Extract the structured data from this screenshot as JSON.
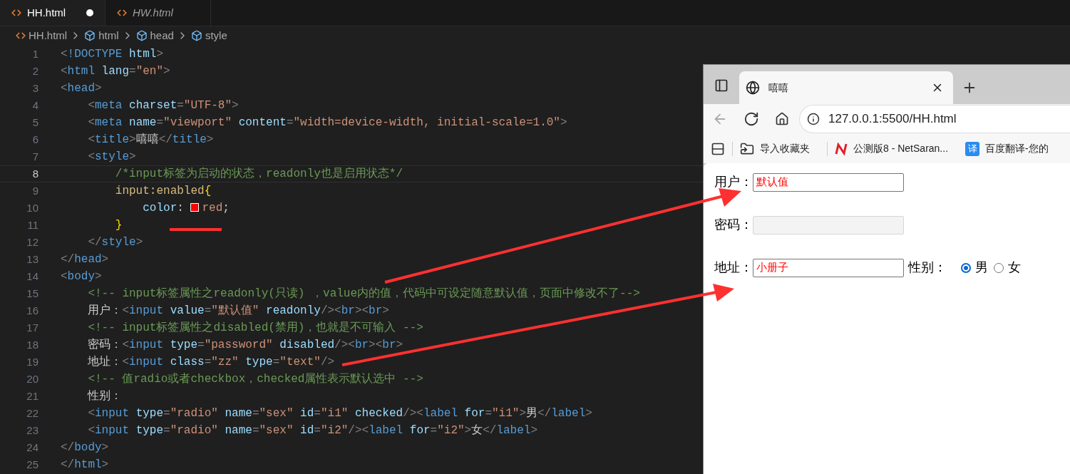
{
  "editor": {
    "tabs": [
      {
        "label": "HH.html",
        "selected": true,
        "modified": true,
        "italic": false
      },
      {
        "label": "HW.html",
        "selected": false,
        "modified": false,
        "italic": true
      }
    ],
    "breadcrumb": [
      {
        "kind": "file",
        "label": "HH.html"
      },
      {
        "kind": "element",
        "label": "html"
      },
      {
        "kind": "element",
        "label": "head"
      },
      {
        "kind": "element",
        "label": "style"
      }
    ],
    "lines": [
      {
        "number": "1",
        "current": false,
        "tokens": [
          {
            "kind": "p",
            "text": "<"
          },
          {
            "kind": "t",
            "text": "!DOCTYPE"
          },
          {
            "kind": "a",
            "text": " html"
          },
          {
            "kind": "p",
            "text": ">"
          }
        ]
      },
      {
        "number": "2",
        "current": false,
        "tokens": [
          {
            "kind": "p",
            "text": "<"
          },
          {
            "kind": "t",
            "text": "html"
          },
          {
            "kind": "a",
            "text": " lang"
          },
          {
            "kind": "p",
            "text": "="
          },
          {
            "kind": "s",
            "text": "\"en\""
          },
          {
            "kind": "p",
            "text": ">"
          }
        ]
      },
      {
        "number": "3",
        "current": false,
        "tokens": [
          {
            "kind": "p",
            "text": "<"
          },
          {
            "kind": "t",
            "text": "head"
          },
          {
            "kind": "p",
            "text": ">"
          }
        ]
      },
      {
        "number": "4",
        "current": false,
        "tokens": [
          {
            "kind": "p",
            "text": "    <"
          },
          {
            "kind": "t",
            "text": "meta"
          },
          {
            "kind": "a",
            "text": " charset"
          },
          {
            "kind": "p",
            "text": "="
          },
          {
            "kind": "s",
            "text": "\"UTF-8\""
          },
          {
            "kind": "p",
            "text": ">"
          }
        ]
      },
      {
        "number": "5",
        "current": false,
        "tokens": [
          {
            "kind": "p",
            "text": "    <"
          },
          {
            "kind": "t",
            "text": "meta"
          },
          {
            "kind": "a",
            "text": " name"
          },
          {
            "kind": "p",
            "text": "="
          },
          {
            "kind": "s",
            "text": "\"viewport\""
          },
          {
            "kind": "a",
            "text": " content"
          },
          {
            "kind": "p",
            "text": "="
          },
          {
            "kind": "s",
            "text": "\"width=device-width, initial-scale=1.0\""
          },
          {
            "kind": "p",
            "text": ">"
          }
        ]
      },
      {
        "number": "6",
        "current": false,
        "tokens": [
          {
            "kind": "p",
            "text": "    <"
          },
          {
            "kind": "t",
            "text": "title"
          },
          {
            "kind": "p",
            "text": ">"
          },
          {
            "kind": "x",
            "text": "嘻嘻"
          },
          {
            "kind": "p",
            "text": "</"
          },
          {
            "kind": "t",
            "text": "title"
          },
          {
            "kind": "p",
            "text": ">"
          }
        ]
      },
      {
        "number": "7",
        "current": false,
        "tokens": [
          {
            "kind": "p",
            "text": "    <"
          },
          {
            "kind": "t",
            "text": "style"
          },
          {
            "kind": "p",
            "text": ">"
          }
        ]
      },
      {
        "number": "8",
        "current": true,
        "tokens": [
          {
            "kind": "c",
            "text": "        /*input标签为启动的状态，readonly也是启用状态*/"
          }
        ]
      },
      {
        "number": "9",
        "current": false,
        "tokens": [
          {
            "kind": "sel",
            "text": "        input:enabled"
          },
          {
            "kind": "b",
            "text": "{"
          }
        ]
      },
      {
        "number": "10",
        "current": false,
        "tokens": [
          {
            "kind": "a",
            "text": "            color"
          },
          {
            "kind": "x",
            "text": ": "
          },
          {
            "kind": "swatch",
            "color": "#ff0000"
          },
          {
            "kind": "s",
            "text": "red"
          },
          {
            "kind": "x",
            "text": ";"
          }
        ]
      },
      {
        "number": "11",
        "current": false,
        "tokens": [
          {
            "kind": "b",
            "text": "        }"
          }
        ]
      },
      {
        "number": "12",
        "current": false,
        "tokens": [
          {
            "kind": "p",
            "text": "    </"
          },
          {
            "kind": "t",
            "text": "style"
          },
          {
            "kind": "p",
            "text": ">"
          }
        ]
      },
      {
        "number": "13",
        "current": false,
        "tokens": [
          {
            "kind": "p",
            "text": "</"
          },
          {
            "kind": "t",
            "text": "head"
          },
          {
            "kind": "p",
            "text": ">"
          }
        ]
      },
      {
        "number": "14",
        "current": false,
        "tokens": [
          {
            "kind": "p",
            "text": "<"
          },
          {
            "kind": "t",
            "text": "body"
          },
          {
            "kind": "p",
            "text": ">"
          }
        ]
      },
      {
        "number": "15",
        "current": false,
        "tokens": [
          {
            "kind": "c",
            "text": "    <!-- input标签属性之readonly(只读) ，value内的值，代码中可设定随意默认值，页面中修改不了-->"
          }
        ]
      },
      {
        "number": "16",
        "current": false,
        "tokens": [
          {
            "kind": "x",
            "text": "    用户："
          },
          {
            "kind": "p",
            "text": "<"
          },
          {
            "kind": "t",
            "text": "input"
          },
          {
            "kind": "a",
            "text": " value"
          },
          {
            "kind": "p",
            "text": "="
          },
          {
            "kind": "s",
            "text": "\"默认值\""
          },
          {
            "kind": "a",
            "text": " readonly"
          },
          {
            "kind": "p",
            "text": "/><"
          },
          {
            "kind": "t",
            "text": "br"
          },
          {
            "kind": "p",
            "text": "><"
          },
          {
            "kind": "t",
            "text": "br"
          },
          {
            "kind": "p",
            "text": ">"
          }
        ]
      },
      {
        "number": "17",
        "current": false,
        "tokens": [
          {
            "kind": "c",
            "text": "    <!-- input标签属性之disabled(禁用)，也就是不可输入 -->"
          }
        ]
      },
      {
        "number": "18",
        "current": false,
        "tokens": [
          {
            "kind": "x",
            "text": "    密码："
          },
          {
            "kind": "p",
            "text": "<"
          },
          {
            "kind": "t",
            "text": "input"
          },
          {
            "kind": "a",
            "text": " type"
          },
          {
            "kind": "p",
            "text": "="
          },
          {
            "kind": "s",
            "text": "\"password\""
          },
          {
            "kind": "a",
            "text": " disabled"
          },
          {
            "kind": "p",
            "text": "/><"
          },
          {
            "kind": "t",
            "text": "br"
          },
          {
            "kind": "p",
            "text": "><"
          },
          {
            "kind": "t",
            "text": "br"
          },
          {
            "kind": "p",
            "text": ">"
          }
        ]
      },
      {
        "number": "19",
        "current": false,
        "tokens": [
          {
            "kind": "x",
            "text": "    地址："
          },
          {
            "kind": "p",
            "text": "<"
          },
          {
            "kind": "t",
            "text": "input"
          },
          {
            "kind": "a",
            "text": " class"
          },
          {
            "kind": "p",
            "text": "="
          },
          {
            "kind": "s",
            "text": "\"zz\""
          },
          {
            "kind": "a",
            "text": " type"
          },
          {
            "kind": "p",
            "text": "="
          },
          {
            "kind": "s",
            "text": "\"text\""
          },
          {
            "kind": "p",
            "text": "/>"
          }
        ]
      },
      {
        "number": "20",
        "current": false,
        "tokens": [
          {
            "kind": "c",
            "text": "    <!-- 值radio或者checkbox，checked属性表示默认选中 -->"
          }
        ]
      },
      {
        "number": "21",
        "current": false,
        "tokens": [
          {
            "kind": "x",
            "text": "    性别："
          }
        ]
      },
      {
        "number": "22",
        "current": false,
        "tokens": [
          {
            "kind": "p",
            "text": "    <"
          },
          {
            "kind": "t",
            "text": "input"
          },
          {
            "kind": "a",
            "text": " type"
          },
          {
            "kind": "p",
            "text": "="
          },
          {
            "kind": "s",
            "text": "\"radio\""
          },
          {
            "kind": "a",
            "text": " name"
          },
          {
            "kind": "p",
            "text": "="
          },
          {
            "kind": "s",
            "text": "\"sex\""
          },
          {
            "kind": "a",
            "text": " id"
          },
          {
            "kind": "p",
            "text": "="
          },
          {
            "kind": "s",
            "text": "\"i1\""
          },
          {
            "kind": "a",
            "text": " checked"
          },
          {
            "kind": "p",
            "text": "/><"
          },
          {
            "kind": "t",
            "text": "label"
          },
          {
            "kind": "a",
            "text": " for"
          },
          {
            "kind": "p",
            "text": "="
          },
          {
            "kind": "s",
            "text": "\"i1\""
          },
          {
            "kind": "p",
            "text": ">"
          },
          {
            "kind": "x",
            "text": "男"
          },
          {
            "kind": "p",
            "text": "</"
          },
          {
            "kind": "t",
            "text": "label"
          },
          {
            "kind": "p",
            "text": ">"
          }
        ]
      },
      {
        "number": "23",
        "current": false,
        "tokens": [
          {
            "kind": "p",
            "text": "    <"
          },
          {
            "kind": "t",
            "text": "input"
          },
          {
            "kind": "a",
            "text": " type"
          },
          {
            "kind": "p",
            "text": "="
          },
          {
            "kind": "s",
            "text": "\"radio\""
          },
          {
            "kind": "a",
            "text": " name"
          },
          {
            "kind": "p",
            "text": "="
          },
          {
            "kind": "s",
            "text": "\"sex\""
          },
          {
            "kind": "a",
            "text": " id"
          },
          {
            "kind": "p",
            "text": "="
          },
          {
            "kind": "s",
            "text": "\"i2\""
          },
          {
            "kind": "p",
            "text": "/><"
          },
          {
            "kind": "t",
            "text": "label"
          },
          {
            "kind": "a",
            "text": " for"
          },
          {
            "kind": "p",
            "text": "="
          },
          {
            "kind": "s",
            "text": "\"i2\""
          },
          {
            "kind": "p",
            "text": ">"
          },
          {
            "kind": "x",
            "text": "女"
          },
          {
            "kind": "p",
            "text": "</"
          },
          {
            "kind": "t",
            "text": "label"
          },
          {
            "kind": "p",
            "text": ">"
          }
        ]
      },
      {
        "number": "24",
        "current": false,
        "tokens": [
          {
            "kind": "p",
            "text": "</"
          },
          {
            "kind": "t",
            "text": "body"
          },
          {
            "kind": "p",
            "text": ">"
          }
        ]
      },
      {
        "number": "25",
        "current": false,
        "tokens": [
          {
            "kind": "p",
            "text": "</"
          },
          {
            "kind": "t",
            "text": "html"
          },
          {
            "kind": "p",
            "text": ">"
          }
        ]
      }
    ]
  },
  "browser": {
    "tab": {
      "title": "嘻嘻"
    },
    "address": "127.0.0.1:5500/HH.html",
    "bookmarks": [
      {
        "kind": "folder",
        "label": "导入收藏夹"
      },
      {
        "kind": "netsarang",
        "label": "公测版8 - NetSaran..."
      },
      {
        "kind": "translate",
        "icon_text": "译",
        "label": "百度翻译-您的"
      }
    ],
    "form": {
      "fields": [
        {
          "label": "用户：",
          "value": "默认值",
          "disabled": false
        },
        {
          "label": "密码：",
          "disabled": true
        },
        {
          "label": "地址：",
          "value": "小册子",
          "disabled": false
        }
      ],
      "gender": {
        "label": "性别：",
        "options": [
          {
            "label": "男",
            "selected": true
          },
          {
            "label": "女",
            "selected": false
          }
        ]
      }
    }
  }
}
